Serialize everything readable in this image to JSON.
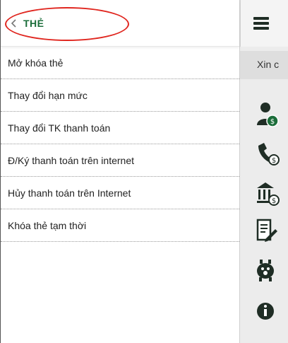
{
  "drawer": {
    "title": "THẺ",
    "items": [
      {
        "label": "Mở khóa thẻ"
      },
      {
        "label": "Thay đổi hạn mức"
      },
      {
        "label": "Thay đổi TK thanh toán"
      },
      {
        "label": "Đ/Ký thanh toán trên internet"
      },
      {
        "label": "Hủy thanh toán trên Internet"
      },
      {
        "label": "Khóa thẻ tạm thời"
      }
    ]
  },
  "background": {
    "greeting": "Xin c",
    "icons": [
      "user-dollar-icon",
      "phone-dollar-icon",
      "bank-dollar-icon",
      "document-edit-icon",
      "piggy-bank-icon",
      "info-icon"
    ]
  },
  "colors": {
    "accent": "#1b6d3a",
    "highlight_circle": "#e0261f",
    "icon_dark": "#1f2d25"
  }
}
